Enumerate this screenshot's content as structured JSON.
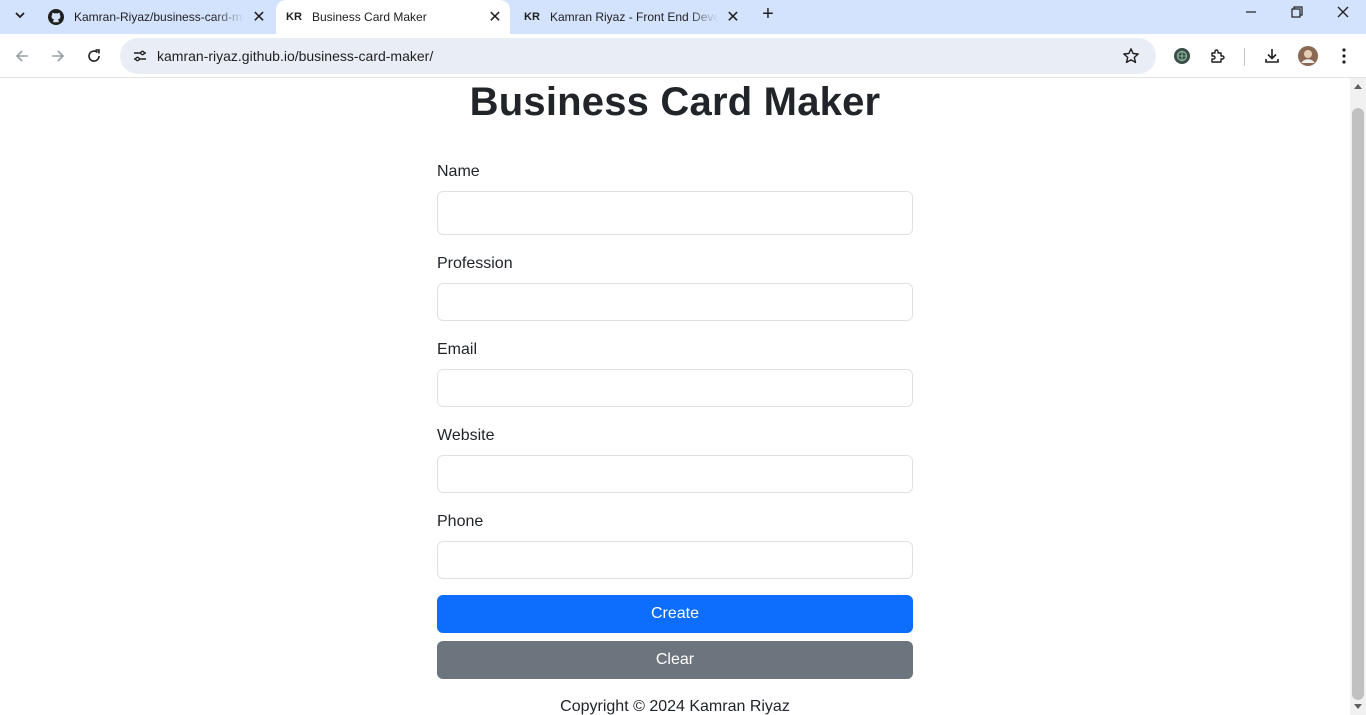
{
  "browser": {
    "tabs": [
      {
        "title": "Kamran-Riyaz/business-card-maker",
        "favicon": "github-icon",
        "active": false
      },
      {
        "title": "Business Card Maker",
        "favicon_text": "KR",
        "active": true
      },
      {
        "title": "Kamran Riyaz - Front End Developer",
        "favicon_text": "KR",
        "active": false
      }
    ],
    "url": "kamran-riyaz.github.io/business-card-maker/"
  },
  "page": {
    "title": "Business Card Maker",
    "fields": [
      {
        "label": "Name",
        "value": ""
      },
      {
        "label": "Profession",
        "value": ""
      },
      {
        "label": "Email",
        "value": ""
      },
      {
        "label": "Website",
        "value": ""
      },
      {
        "label": "Phone",
        "value": ""
      }
    ],
    "create_label": "Create",
    "clear_label": "Clear",
    "footer": "Copyright © 2024 Kamran Riyaz"
  },
  "colors": {
    "primary": "#0d6efd",
    "secondary": "#6c757d",
    "tabbar": "#d3e3fd"
  }
}
